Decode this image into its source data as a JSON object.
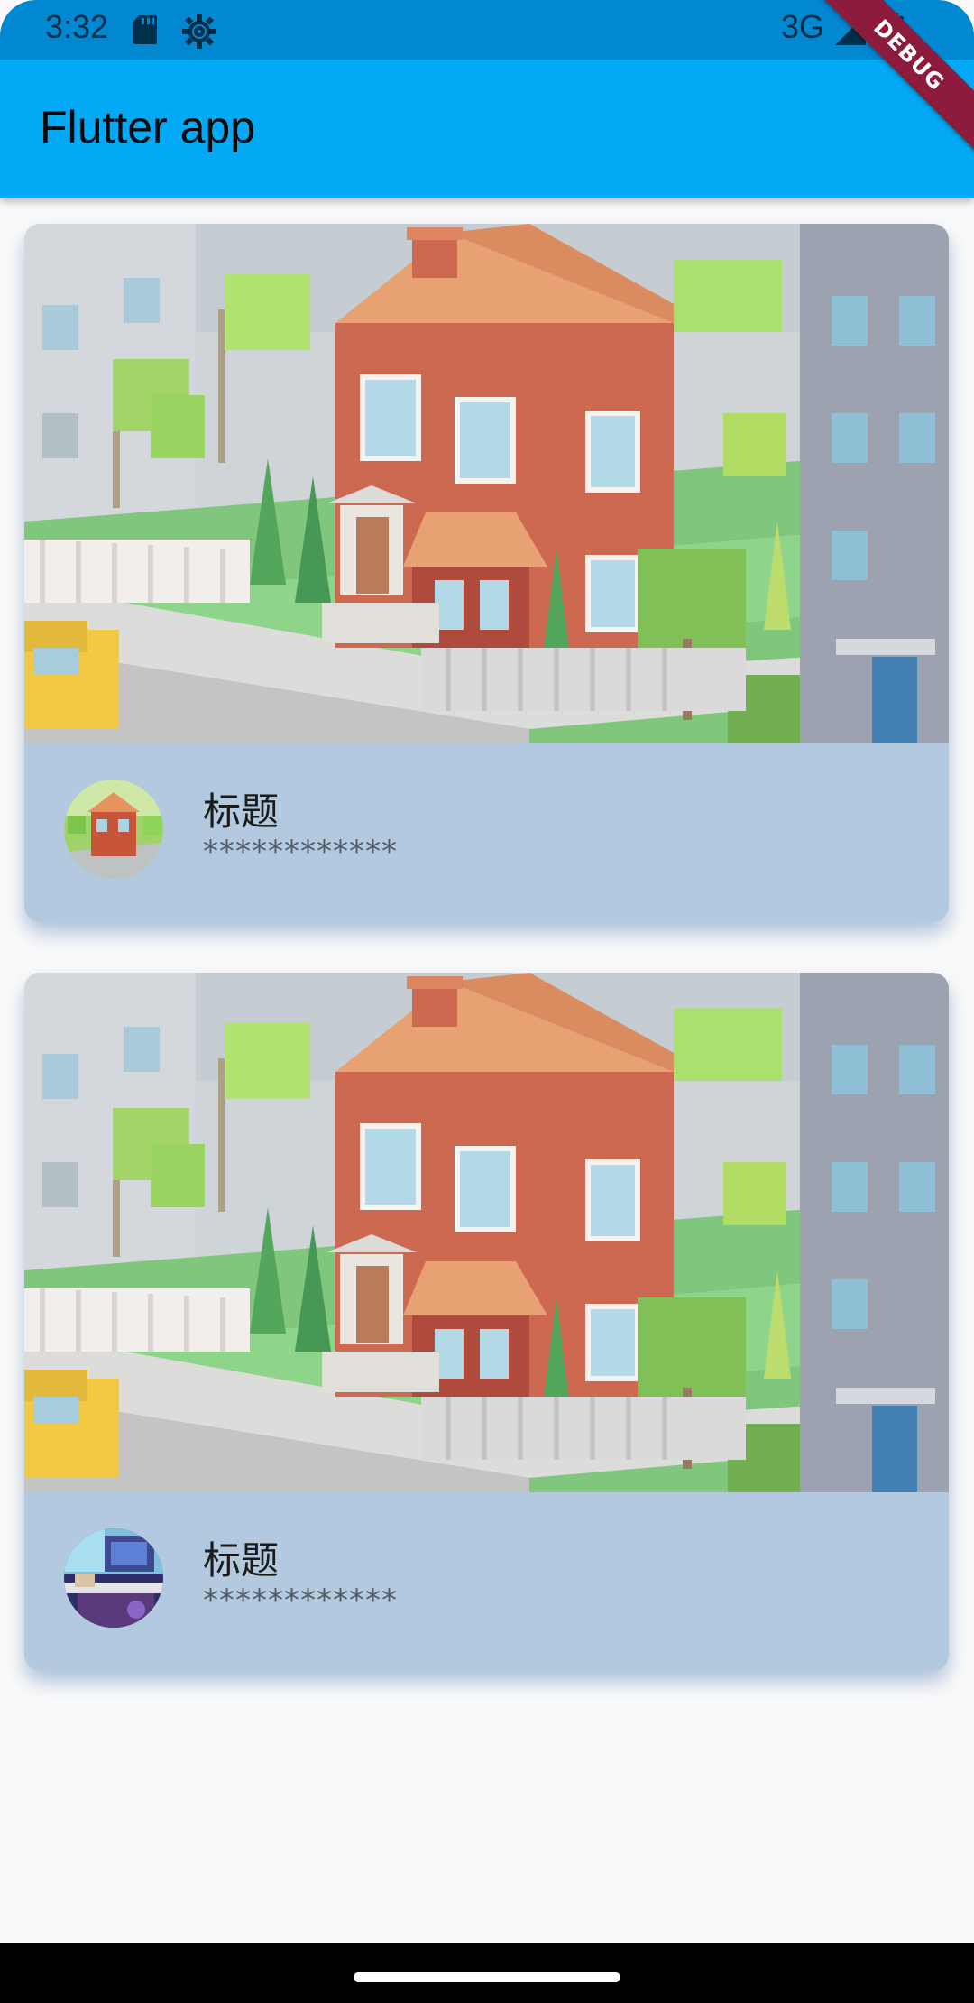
{
  "status_bar": {
    "time": "3:32",
    "network": "3G",
    "icons": [
      "sd-card-icon",
      "gear-icon",
      "signal-icon",
      "battery-icon"
    ],
    "color": "#0288d1"
  },
  "app_bar": {
    "title": "Flutter app",
    "color": "#03a9f4"
  },
  "debug_banner": {
    "label": "DEBUG",
    "color": "#8d1b3d"
  },
  "cards": [
    {
      "title": "标题",
      "subtitle": "************",
      "avatar": "house-avatar"
    },
    {
      "title": "标题",
      "subtitle": "************",
      "avatar": "desk-room-avatar"
    }
  ],
  "colors": {
    "card_background": "#b3c9e0",
    "page_background": "#fafafa"
  }
}
